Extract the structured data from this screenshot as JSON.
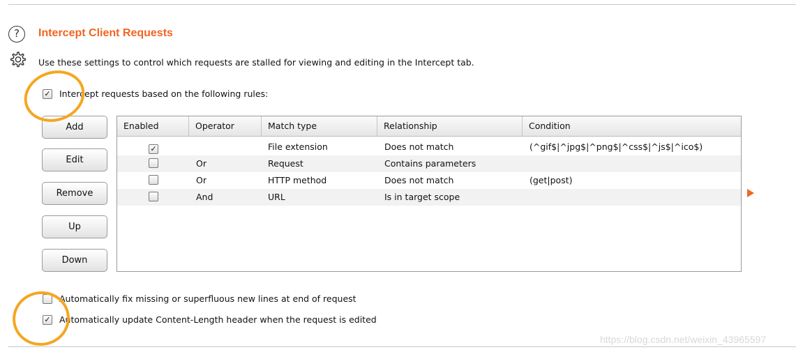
{
  "section": {
    "title": "Intercept Client Requests",
    "description": "Use these settings to control which requests are stalled for viewing and editing in the Intercept tab.",
    "help_icon_glyph": "?"
  },
  "intercept_toggle": {
    "label": "Intercept requests based on the following rules:",
    "checked": true
  },
  "buttons": {
    "add": "Add",
    "edit": "Edit",
    "remove": "Remove",
    "up": "Up",
    "down": "Down"
  },
  "table": {
    "columns": [
      "Enabled",
      "Operator",
      "Match type",
      "Relationship",
      "Condition"
    ],
    "rows": [
      {
        "enabled": true,
        "operator": "",
        "match_type": "File extension",
        "relationship": "Does not match",
        "condition": "(^gif$|^jpg$|^png$|^css$|^js$|^ico$)"
      },
      {
        "enabled": false,
        "operator": "Or",
        "match_type": "Request",
        "relationship": "Contains parameters",
        "condition": ""
      },
      {
        "enabled": false,
        "operator": "Or",
        "match_type": "HTTP method",
        "relationship": "Does not match",
        "condition": "(get|post)"
      },
      {
        "enabled": false,
        "operator": "And",
        "match_type": "URL",
        "relationship": "Is in target scope",
        "condition": ""
      }
    ]
  },
  "options": {
    "fix_newlines": {
      "label": "Automatically fix missing or superfluous new lines at end of request",
      "checked": false
    },
    "update_content_length": {
      "label": "Automatically update Content-Length header when the request is edited",
      "checked": true
    }
  },
  "watermark": "https://blog.csdn.net/weixin_43965597",
  "colors": {
    "accent": "#f26522",
    "annotation": "#f5a623"
  },
  "check_glyph": "✓"
}
